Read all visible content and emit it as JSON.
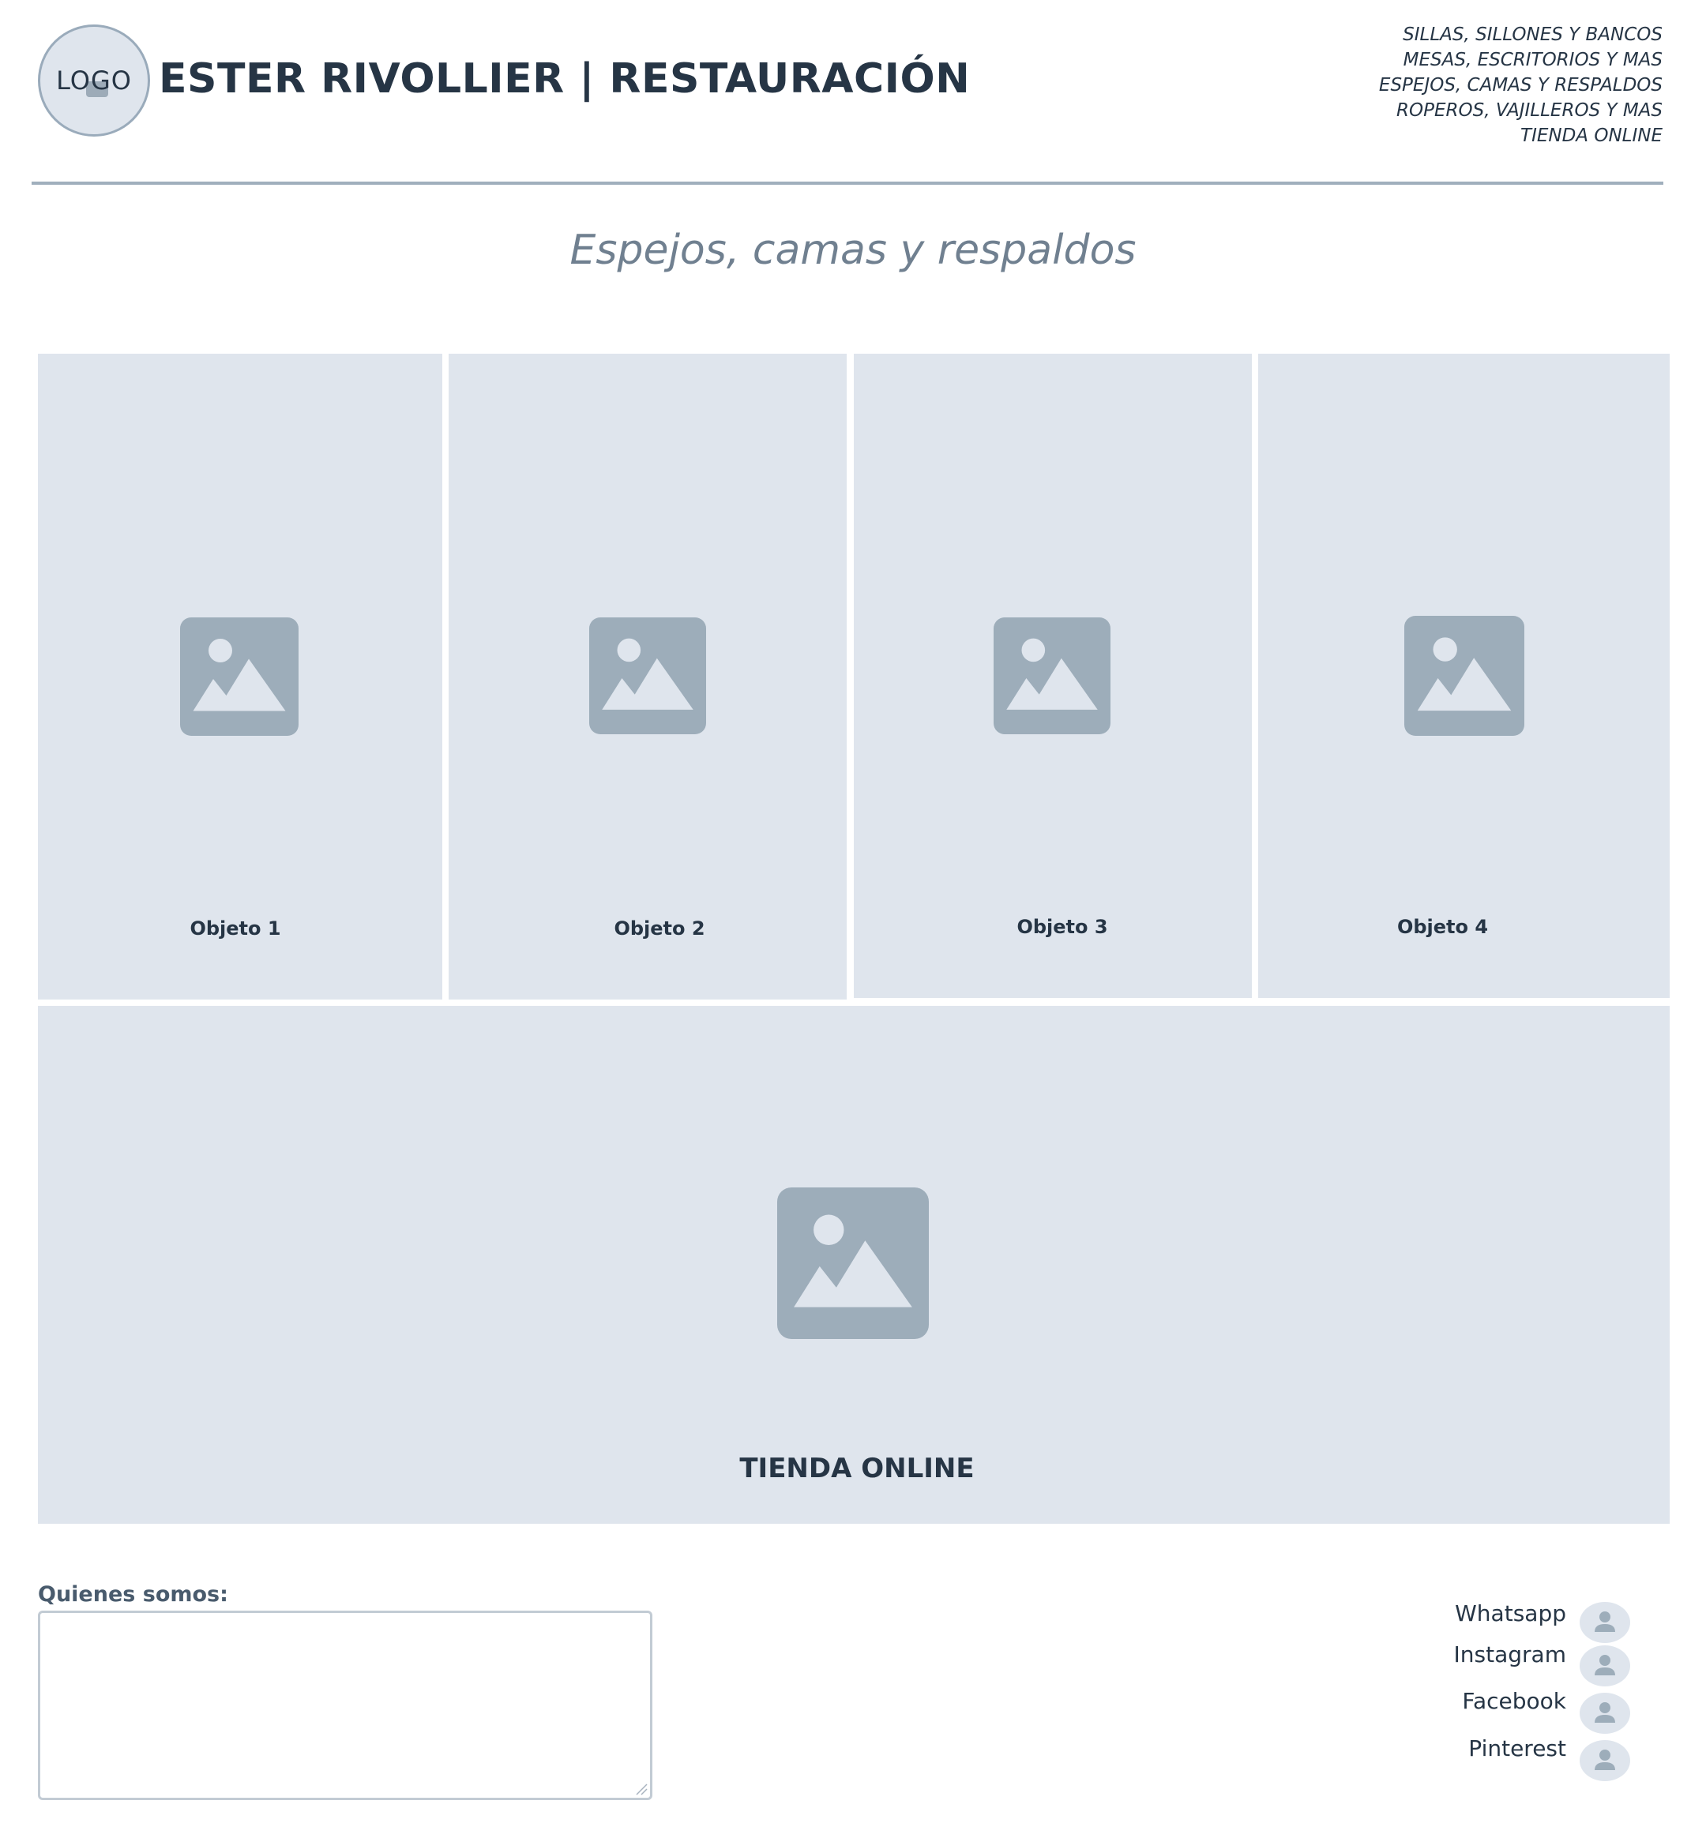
{
  "header": {
    "logo_text": "LOGO",
    "title": "ESTER RIVOLLIER | RESTAURACIÓN",
    "nav": [
      "SILLAS, SILLONES Y BANCOS",
      "MESAS, ESCRITORIOS Y MAS",
      "ESPEJOS, CAMAS Y RESPALDOS",
      "ROPEROS, VAJILLEROS Y MAS",
      "TIENDA ONLINE"
    ]
  },
  "page": {
    "heading": "Espejos, camas y respaldos"
  },
  "products": [
    {
      "label": "Objeto 1",
      "icon": "image-placeholder-icon"
    },
    {
      "label": "Objeto 2",
      "icon": "image-placeholder-icon"
    },
    {
      "label": "Objeto 3",
      "icon": "image-placeholder-icon"
    },
    {
      "label": "Objeto 4",
      "icon": "image-placeholder-icon"
    }
  ],
  "shop": {
    "label": "TIENDA ONLINE",
    "icon": "image-placeholder-icon"
  },
  "about": {
    "label": "Quienes somos:",
    "value": ""
  },
  "social": [
    {
      "label": "Whatsapp",
      "icon": "user-avatar-icon"
    },
    {
      "label": "Instagram",
      "icon": "user-avatar-icon"
    },
    {
      "label": "Facebook",
      "icon": "user-avatar-icon"
    },
    {
      "label": "Pinterest",
      "icon": "user-avatar-icon"
    }
  ],
  "colors": {
    "placeholder_bg": "#dfe5ed",
    "placeholder_icon": "#9dadba",
    "text_dark": "#263545",
    "heading_muted": "#708090",
    "rule": "#a0afbd"
  }
}
